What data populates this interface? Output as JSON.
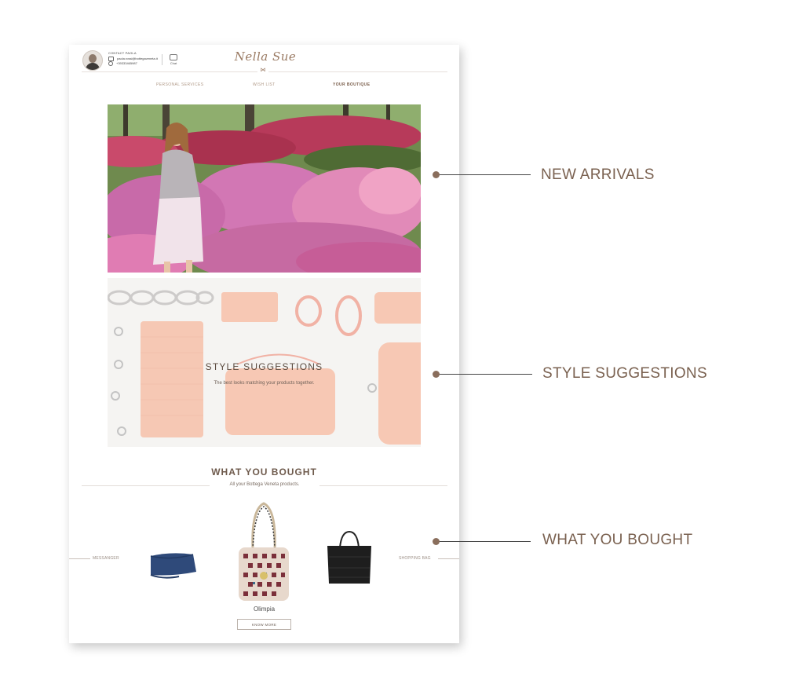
{
  "header": {
    "contact_title": "CONTACT PAOLA",
    "email": "paola.rossi@bottegaveneta.it",
    "phone": "+39333465987",
    "chat_label": "Chat",
    "logo_text": "Nella Sue"
  },
  "nav": {
    "items": [
      {
        "label": "PERSONAL SERVICES",
        "active": false
      },
      {
        "label": "WISH LIST",
        "active": false
      },
      {
        "label": "YOUR BOUTIQUE",
        "active": true
      }
    ]
  },
  "style_suggestions": {
    "title": "STYLE SUGGESTIONS",
    "subtitle": "The best looks matching your products together."
  },
  "what_you_bought": {
    "title": "WHAT YOU BOUGHT",
    "subtitle": "All your Bottega Veneta products.",
    "left_label": "MESSANGER",
    "right_label": "SHOPPING BAG",
    "featured_name": "Olimpia",
    "know_more_label": "KNOW MORE"
  },
  "annotations": [
    {
      "label": "NEW ARRIVALS"
    },
    {
      "label": "STYLE SUGGESTIONS"
    },
    {
      "label": "WHAT YOU BOUGHT"
    }
  ],
  "colors": {
    "accent_brown": "#7a6150",
    "dot_brown": "#8a6e5c",
    "weave_orange": "#f2a07f"
  }
}
